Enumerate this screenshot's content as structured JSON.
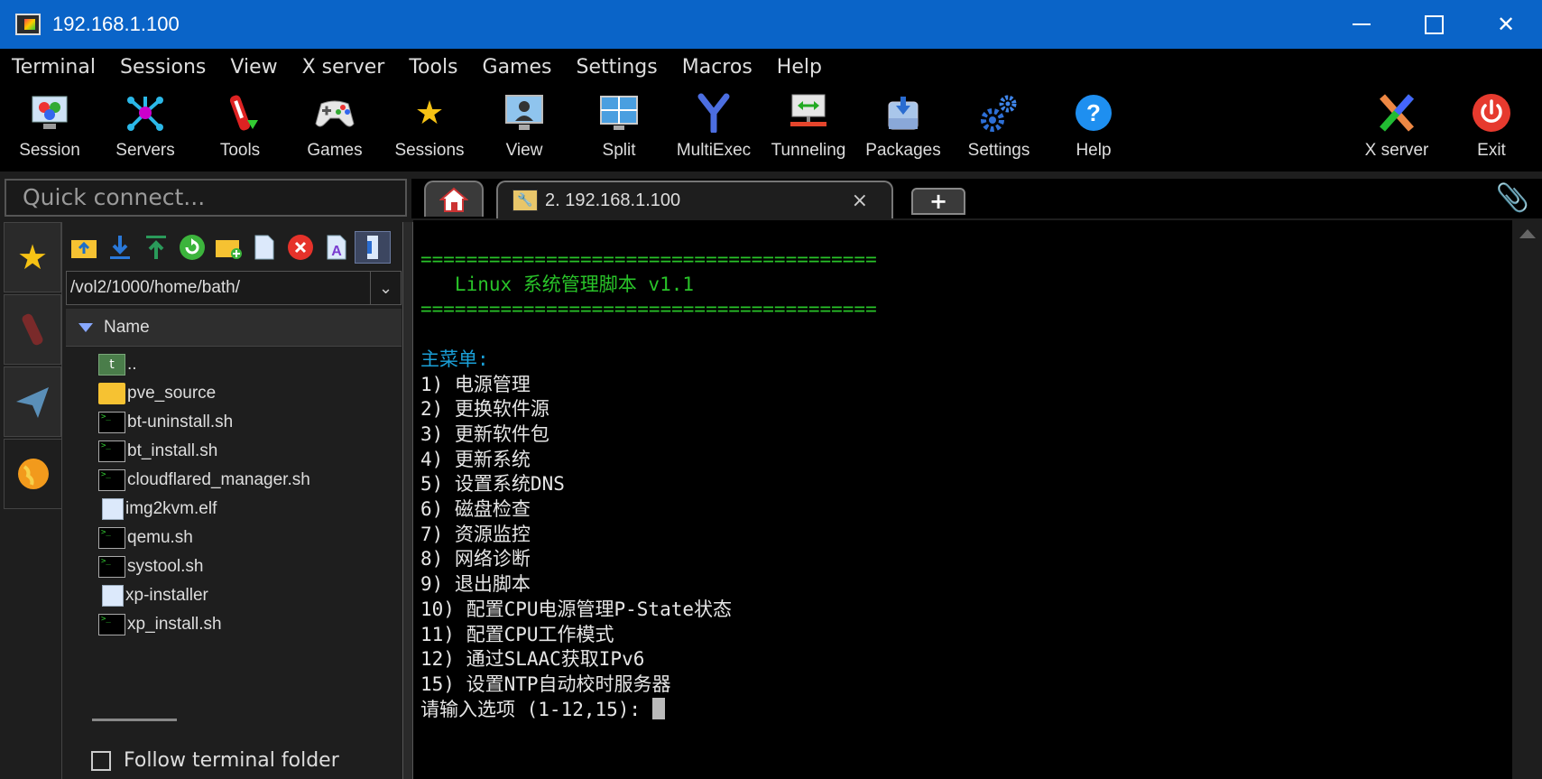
{
  "window": {
    "title": "192.168.1.100"
  },
  "menu": [
    "Terminal",
    "Sessions",
    "View",
    "X server",
    "Tools",
    "Games",
    "Settings",
    "Macros",
    "Help"
  ],
  "toolbar": {
    "left": [
      {
        "label": "Session",
        "icon": "session-icon"
      },
      {
        "label": "Servers",
        "icon": "servers-icon"
      },
      {
        "label": "Tools",
        "icon": "tools-icon"
      },
      {
        "label": "Games",
        "icon": "games-icon"
      },
      {
        "label": "Sessions",
        "icon": "star-icon"
      },
      {
        "label": "View",
        "icon": "view-icon"
      },
      {
        "label": "Split",
        "icon": "split-icon"
      },
      {
        "label": "MultiExec",
        "icon": "multiexec-icon"
      },
      {
        "label": "Tunneling",
        "icon": "tunneling-icon"
      },
      {
        "label": "Packages",
        "icon": "packages-icon"
      },
      {
        "label": "Settings",
        "icon": "gear-icon"
      },
      {
        "label": "Help",
        "icon": "help-icon"
      }
    ],
    "right": [
      {
        "label": "X server",
        "icon": "xserver-icon"
      },
      {
        "label": "Exit",
        "icon": "power-icon"
      }
    ]
  },
  "quick_connect": {
    "placeholder": "Quick connect..."
  },
  "tabs": {
    "session_label": "2. 192.168.1.100",
    "close": "×",
    "new": "+"
  },
  "sftp": {
    "path": "/vol2/1000/home/bath/",
    "column": "Name",
    "files": [
      {
        "name": "..",
        "type": "up"
      },
      {
        "name": "pve_source",
        "type": "folder"
      },
      {
        "name": "bt-uninstall.sh",
        "type": "script"
      },
      {
        "name": "bt_install.sh",
        "type": "script"
      },
      {
        "name": "cloudflared_manager.sh",
        "type": "script"
      },
      {
        "name": "img2kvm.elf",
        "type": "file"
      },
      {
        "name": "qemu.sh",
        "type": "script"
      },
      {
        "name": "systool.sh",
        "type": "script"
      },
      {
        "name": "xp-installer",
        "type": "file"
      },
      {
        "name": "xp_install.sh",
        "type": "script"
      }
    ],
    "follow_label": "Follow terminal folder"
  },
  "terminal": {
    "rule": "========================================",
    "header": "   Linux 系统管理脚本 v1.1",
    "menu_title": "主菜单:",
    "options": [
      "1) 电源管理",
      "2) 更换软件源",
      "3) 更新软件包",
      "4) 更新系统",
      "5) 设置系统DNS",
      "6) 磁盘检查",
      "7) 资源监控",
      "8) 网络诊断",
      "9) 退出脚本",
      "10) 配置CPU电源管理P-State状态",
      "11) 配置CPU工作模式",
      "12) 通过SLAAC获取IPv6",
      "15) 设置NTP自动校时服务器"
    ],
    "prompt": "请输入选项 (1-12,15): "
  }
}
